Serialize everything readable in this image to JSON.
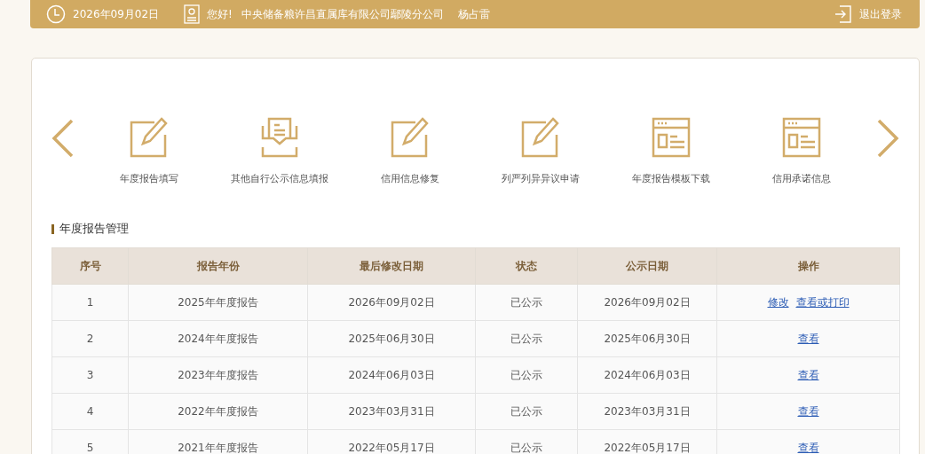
{
  "header": {
    "date": "2026年09月02日",
    "greeting": "您好!",
    "company": "中央储备粮许昌直属库有限公司鄢陵分公司",
    "user": "杨占雷",
    "logout": "退出登录"
  },
  "shortcuts": [
    {
      "label": "年度报告填写",
      "kind": "edit"
    },
    {
      "label": "其他自行公示信息填报",
      "kind": "inbox"
    },
    {
      "label": "信用信息修复",
      "kind": "edit"
    },
    {
      "label": "列严列异异议申请",
      "kind": "edit"
    },
    {
      "label": "年度报告模板下载",
      "kind": "window"
    },
    {
      "label": "信用承诺信息",
      "kind": "window"
    }
  ],
  "section_title": "年度报告管理",
  "table": {
    "columns": [
      "序号",
      "报告年份",
      "最后修改日期",
      "状态",
      "公示日期",
      "操作"
    ],
    "rows": [
      {
        "cells": [
          "1",
          "2025年年度报告",
          "2026年09月02日",
          "已公示",
          "2026年09月02日"
        ],
        "actions": [
          "修改",
          "查看或打印"
        ]
      },
      {
        "cells": [
          "2",
          "2024年年度报告",
          "2025年06月30日",
          "已公示",
          "2025年06月30日"
        ],
        "actions": [
          "查看"
        ]
      },
      {
        "cells": [
          "3",
          "2023年年度报告",
          "2024年06月03日",
          "已公示",
          "2024年06月03日"
        ],
        "actions": [
          "查看"
        ]
      },
      {
        "cells": [
          "4",
          "2022年年度报告",
          "2023年03月31日",
          "已公示",
          "2023年03月31日"
        ],
        "actions": [
          "查看"
        ]
      },
      {
        "cells": [
          "5",
          "2021年年度报告",
          "2022年05月17日",
          "已公示",
          "2022年05月17日"
        ],
        "actions": [
          "查看"
        ]
      }
    ]
  }
}
